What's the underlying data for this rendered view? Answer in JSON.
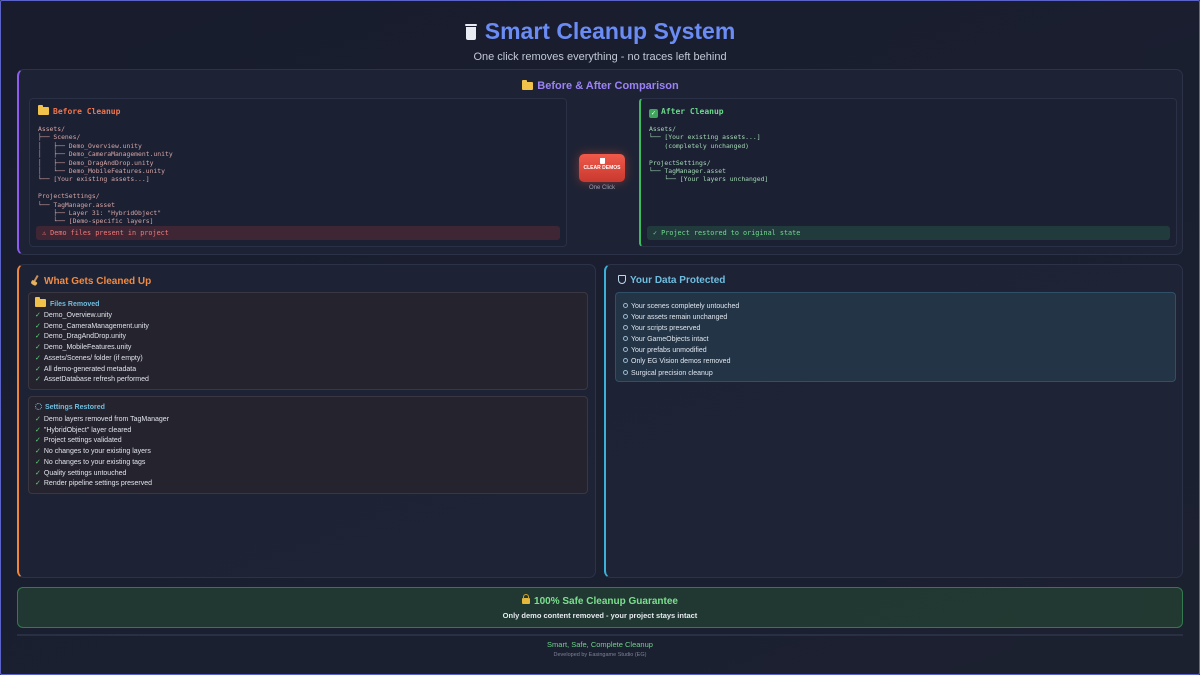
{
  "header": {
    "title": "Smart Cleanup System",
    "subtitle": "One click removes everything - no traces left behind",
    "icon": "trash-icon"
  },
  "comparison": {
    "title": "Before & After Comparison",
    "before": {
      "title": "Before Cleanup",
      "tree": "Assets/\n├── Scenes/\n│   ├── Demo_Overview.unity\n│   ├── Demo_CameraManagement.unity\n│   ├── Demo_DragAndDrop.unity\n│   └── Demo_MobileFeatures.unity\n└── [Your existing assets...]\n\nProjectSettings/\n└── TagManager.asset\n    ├── Layer 31: \"HybridObject\"\n    └── [Demo-specific layers]",
      "status": "⚠ Demo files present in project"
    },
    "button": {
      "label": "CLEAR DEMOS",
      "caption": "One Click"
    },
    "after": {
      "title": "After Cleanup",
      "tree": "Assets/\n└── [Your existing assets...]\n    (completely unchanged)\n\nProjectSettings/\n└── TagManager.asset\n    └── [Your layers unchanged]",
      "status": "✓ Project restored to original state"
    }
  },
  "cleaned": {
    "title": "What Gets Cleaned Up",
    "files": {
      "title": "Files Removed",
      "items": [
        "Demo_Overview.unity",
        "Demo_CameraManagement.unity",
        "Demo_DragAndDrop.unity",
        "Demo_MobileFeatures.unity",
        "Assets/Scenes/ folder (if empty)",
        "All demo-generated metadata",
        "AssetDatabase refresh performed"
      ]
    },
    "settings": {
      "title": "Settings Restored",
      "items": [
        "Demo layers removed from TagManager",
        "\"HybridObject\" layer cleared",
        "Project settings validated",
        "No changes to your existing layers",
        "No changes to your existing tags",
        "Quality settings untouched",
        "Render pipeline settings preserved"
      ]
    }
  },
  "protected": {
    "title": "Your Data Protected",
    "items": [
      "Your scenes completely untouched",
      "Your assets remain unchanged",
      "Your scripts preserved",
      "Your GameObjects intact",
      "Your prefabs unmodified",
      "Only EG Vision demos removed",
      "Surgical precision cleanup"
    ]
  },
  "guarantee": {
    "title": "100% Safe Cleanup Guarantee",
    "subtitle": "Only demo content removed - your project stays intact"
  },
  "footer": {
    "tagline": "Smart, Safe, Complete Cleanup",
    "credit": "Developed by Easingame Studio (EG)"
  },
  "colors": {
    "title": "#6b8cf5",
    "comparison_accent": "#8d5cf0",
    "cleaned_accent": "#f0843a",
    "protected_accent": "#3bb0d8",
    "success": "#6bd88b",
    "danger": "#f3774d"
  }
}
